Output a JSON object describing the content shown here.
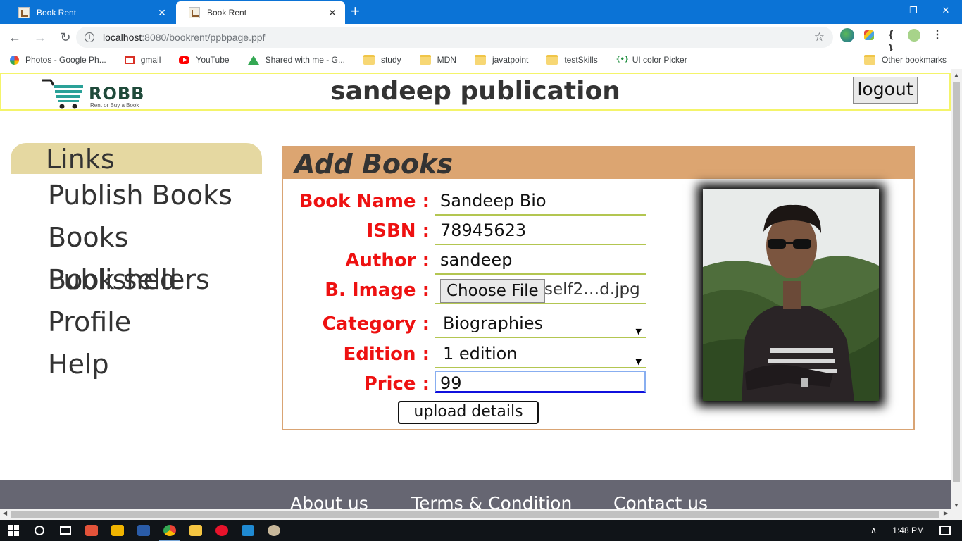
{
  "browser": {
    "tabs": [
      {
        "title": "Book Rent",
        "active": false
      },
      {
        "title": "Book Rent",
        "active": true
      }
    ],
    "new_tab_symbol": "+",
    "window_controls": {
      "minimize": "—",
      "restore": "❐",
      "close": "✕"
    },
    "url_host": "localhost",
    "url_rest": ":8080/bookrent/ppbpage.ppf",
    "bookmarks": [
      {
        "label": "Photos - Google Ph...",
        "icon": "photos-icon"
      },
      {
        "label": "gmail",
        "icon": "gmail-icon"
      },
      {
        "label": "YouTube",
        "icon": "youtube-icon"
      },
      {
        "label": "Shared with me - G...",
        "icon": "drive-icon"
      },
      {
        "label": "study",
        "icon": "folder-icon"
      },
      {
        "label": "MDN",
        "icon": "folder-icon"
      },
      {
        "label": "javatpoint",
        "icon": "folder-icon"
      },
      {
        "label": "testSkills",
        "icon": "folder-icon"
      },
      {
        "label": "UI color Picker",
        "icon": "color-picker-icon"
      }
    ],
    "other_bookmarks": "Other bookmarks"
  },
  "header": {
    "logo_text": "ROBB",
    "logo_tagline": "Rent or Buy a Book",
    "site_title": "sandeep publication",
    "logout_label": "logout"
  },
  "sidebar": {
    "heading": "Links",
    "items": [
      {
        "label": "Publish Books"
      },
      {
        "label": "Books Published"
      },
      {
        "label": "Book sellers"
      },
      {
        "label": "Profile"
      },
      {
        "label": "Help"
      }
    ]
  },
  "form": {
    "title": "Add Books",
    "book_name": {
      "label": "Book Name :",
      "value": "Sandeep Bio"
    },
    "isbn": {
      "label": "ISBN :",
      "value": "78945623"
    },
    "author": {
      "label": "Author :",
      "value": "sandeep"
    },
    "image": {
      "label": "B. Image :",
      "button": "Choose File",
      "file_name": "self2…d.jpg"
    },
    "category": {
      "label": "Category :",
      "selected": "Biographies"
    },
    "edition": {
      "label": "Edition :",
      "selected": "1 edition"
    },
    "price": {
      "label": "Price :",
      "value": "99"
    },
    "submit_label": "upload details"
  },
  "footer": {
    "links": [
      "About us",
      "Terms & Condition",
      "Contact us"
    ]
  },
  "taskbar": {
    "time": "1:48 PM"
  },
  "colors": {
    "accent_blue": "#0b73d6",
    "label_red": "#ee1111",
    "card_header": "#dca571",
    "links_heading": "#e5d8a1",
    "field_underline": "#b3c651",
    "header_border": "#f4f46a",
    "footer_bg": "#666672"
  }
}
